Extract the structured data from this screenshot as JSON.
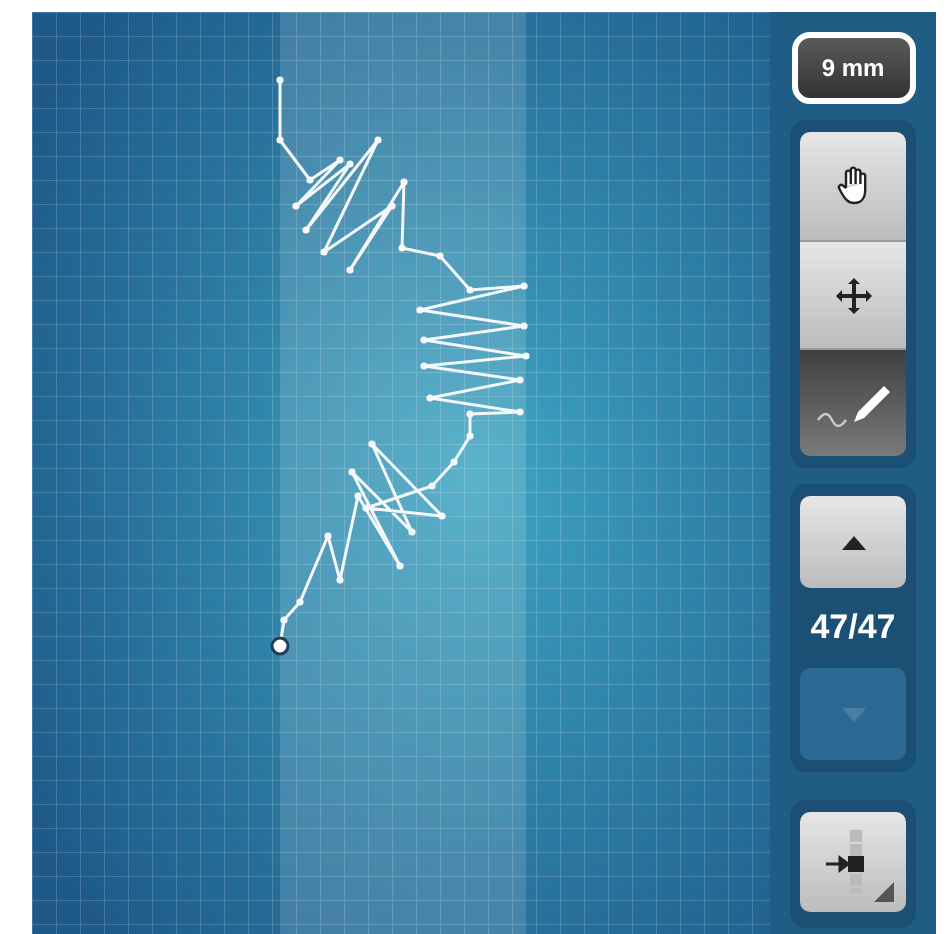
{
  "size_button": {
    "label": "9 mm"
  },
  "tools": [
    {
      "kind": "hand",
      "selected": false
    },
    {
      "kind": "move",
      "selected": false
    },
    {
      "kind": "draw",
      "selected": true
    }
  ],
  "navigation": {
    "up_disabled": false,
    "counter": "47/47",
    "down_disabled": true
  },
  "layout_button": {
    "kind": "layout"
  }
}
